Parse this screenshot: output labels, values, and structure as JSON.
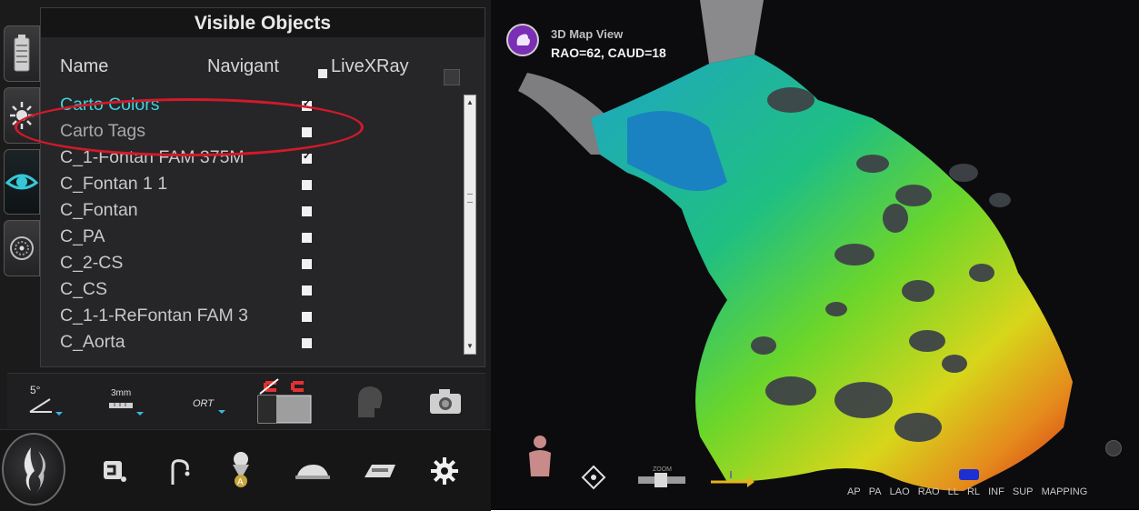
{
  "panel": {
    "title": "Visible Objects",
    "columns": {
      "name": "Name",
      "navigant": "Navigant",
      "livexray": "LiveXRay"
    },
    "items": [
      {
        "name": "Carto Colors",
        "checked": true,
        "color": "#3fd4df"
      },
      {
        "name": "Carto Tags",
        "checked": false
      },
      {
        "name": "C_1-Fontan FAM 375M",
        "checked": true
      },
      {
        "name": "C_Fontan 1 1",
        "checked": false
      },
      {
        "name": "C_Fontan",
        "checked": false
      },
      {
        "name": "C_PA",
        "checked": false
      },
      {
        "name": "C_2-CS",
        "checked": false
      },
      {
        "name": "C_CS",
        "checked": false
      },
      {
        "name": "C_1-1-ReFontan FAM 3",
        "checked": false
      },
      {
        "name": "C_Aorta",
        "checked": false
      }
    ],
    "highlight_color": "#d3192a"
  },
  "side_tabs": [
    "battery-icon",
    "xray-source-icon",
    "eye-icon",
    "dial-icon"
  ],
  "toolbar1": {
    "angle_label": "5°",
    "distance_label": "3mm",
    "ort_label": "ORT",
    "icons": [
      "angle-step-icon",
      "distance-step-icon",
      "ort-icon",
      "magnet-toggle-icon",
      "fluoro-head-icon",
      "camera-icon"
    ]
  },
  "toolbar2": {
    "icons": [
      "stereotaxis-logo",
      "catheter-icon",
      "curve-icon",
      "navigation-icon",
      "table-icon",
      "xray-plate-icon",
      "settings-gear-icon"
    ]
  },
  "map_view": {
    "title": "3D Map View",
    "angle": "RAO=62, CAUD=18",
    "icon_color": "#7b2fb4",
    "zoom_label": "ZOOM",
    "views": [
      "AP",
      "PA",
      "LAO",
      "RAO",
      "LL",
      "RL",
      "INF",
      "SUP",
      "MAPPING"
    ]
  }
}
